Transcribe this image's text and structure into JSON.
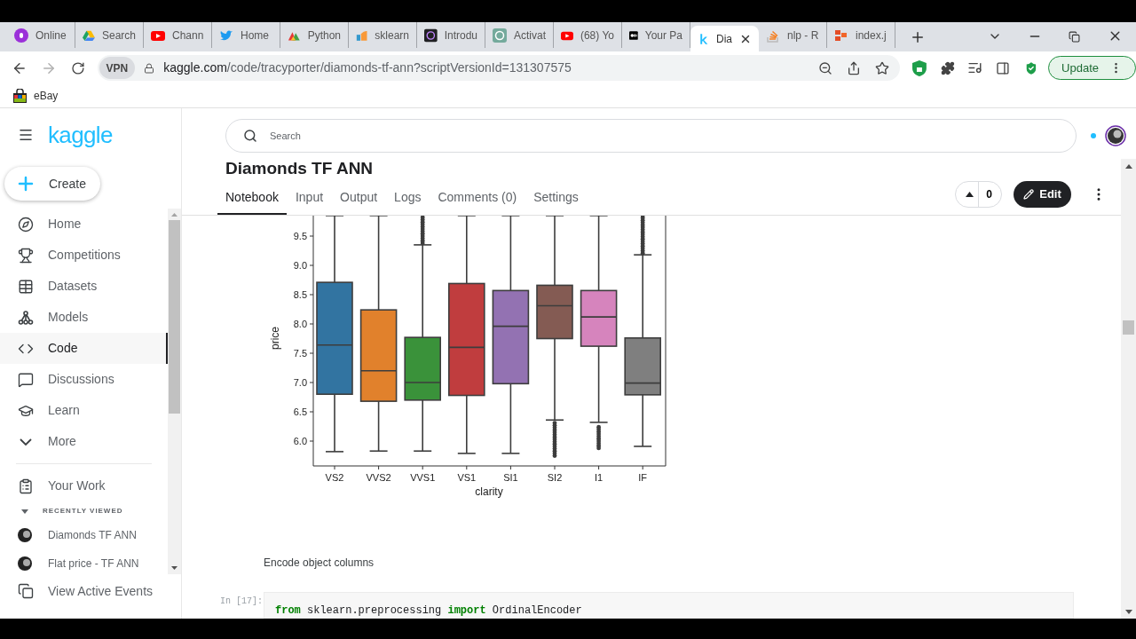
{
  "browser": {
    "tabs": [
      {
        "title": "Online",
        "selected": false
      },
      {
        "title": "Search",
        "selected": false
      },
      {
        "title": "Chann",
        "selected": false
      },
      {
        "title": "Home",
        "selected": false
      },
      {
        "title": "Python",
        "selected": false
      },
      {
        "title": "sklearn",
        "selected": false
      },
      {
        "title": "Introdu",
        "selected": false
      },
      {
        "title": "Activat",
        "selected": false
      },
      {
        "title": "(68) Yo",
        "selected": false
      },
      {
        "title": "Your Pa",
        "selected": false
      },
      {
        "title": "Dia",
        "selected": true
      },
      {
        "title": "nlp - R",
        "selected": false
      },
      {
        "title": "index.j",
        "selected": false
      }
    ],
    "vpn": "VPN",
    "url": {
      "host": "kaggle.com",
      "path": "/code/tracyporter/diamonds-tf-ann?scriptVersionId=131307575"
    },
    "update_button": "Update",
    "bookmarks": [
      {
        "label": "eBay"
      }
    ]
  },
  "sidebar": {
    "logo": "kaggle",
    "create_button": "Create",
    "nav": [
      {
        "label": "Home",
        "selected": false
      },
      {
        "label": "Competitions",
        "selected": false
      },
      {
        "label": "Datasets",
        "selected": false
      },
      {
        "label": "Models",
        "selected": false
      },
      {
        "label": "Code",
        "selected": true
      },
      {
        "label": "Discussions",
        "selected": false
      },
      {
        "label": "Learn",
        "selected": false
      },
      {
        "label": "More",
        "selected": false
      }
    ],
    "your_work": "Your Work",
    "recently_viewed": {
      "heading": "RECENTLY VIEWED",
      "expanded": true,
      "items": [
        {
          "label": "Diamonds TF ANN"
        },
        {
          "label": "Flat price - TF ANN"
        }
      ]
    },
    "view_active_events": "View Active Events"
  },
  "search": {
    "placeholder": "Search"
  },
  "notebook": {
    "title": "Diamonds TF ANN",
    "tabs": [
      {
        "label": "Notebook",
        "selected": true
      },
      {
        "label": "Input",
        "selected": false
      },
      {
        "label": "Output",
        "selected": false
      },
      {
        "label": "Logs",
        "selected": false
      },
      {
        "label": "Comments (0)",
        "selected": false
      },
      {
        "label": "Settings",
        "selected": false
      }
    ],
    "votes": "0",
    "edit_button": "Edit"
  },
  "plot": {
    "ylabel": "price",
    "xlabel": "clarity",
    "yticks": [
      "9.5",
      "9.0",
      "8.5",
      "8.0",
      "7.5",
      "7.0",
      "6.5",
      "6.0"
    ],
    "boxes": [
      {
        "label": "VS2",
        "color": "#3274a1"
      },
      {
        "label": "VVS2",
        "color": "#e1812c"
      },
      {
        "label": "VVS1",
        "color": "#3a923a"
      },
      {
        "label": "VS1",
        "color": "#c03d3e"
      },
      {
        "label": "SI1",
        "color": "#9372b2"
      },
      {
        "label": "SI2",
        "color": "#845b53"
      },
      {
        "label": "I1",
        "color": "#d684bd"
      },
      {
        "label": "IF",
        "color": "#7f7f7f"
      }
    ]
  },
  "markdown_cell": "Encode object columns",
  "code_cell": {
    "prompt": "In [17]:",
    "tokens": [
      {
        "kind": "keyword",
        "text": "from"
      },
      {
        "kind": "plain",
        "text": " sklearn.preprocessing "
      },
      {
        "kind": "keyword",
        "text": "import"
      },
      {
        "kind": "plain",
        "text": " OrdinalEncoder"
      }
    ]
  }
}
